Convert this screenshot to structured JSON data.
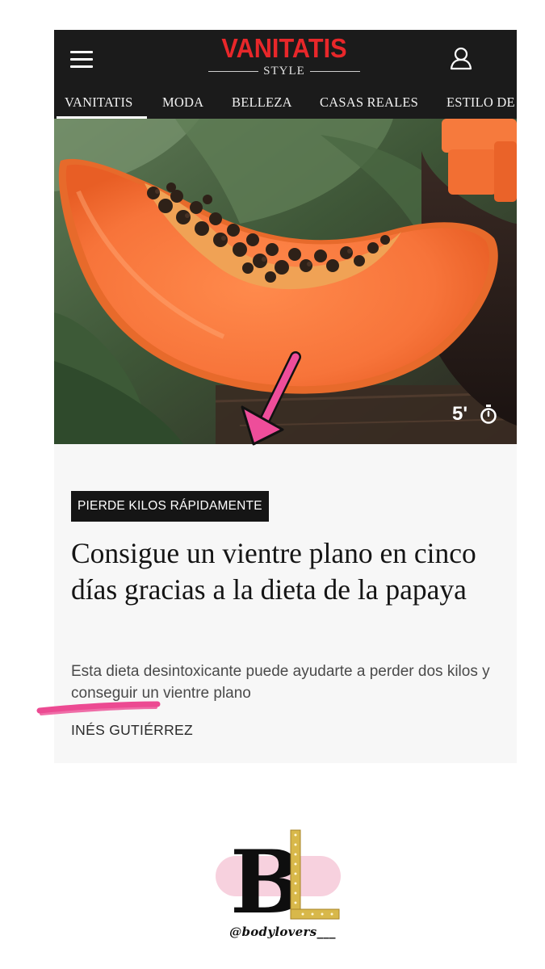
{
  "header": {
    "logo_main": "VANITATIS",
    "logo_sub": "STYLE",
    "menu_icon": "hamburger-menu-icon",
    "user_icon": "user-account-icon"
  },
  "nav": {
    "items": [
      "VANITATIS",
      "MODA",
      "BELLEZA",
      "CASAS REALES",
      "ESTILO DE"
    ],
    "active": "VANITATIS"
  },
  "article": {
    "hero_image": "papaya-slice-photo",
    "reading_time": "5'",
    "timer_icon": "stopwatch-icon",
    "tag": "PIERDE KILOS RÁPIDAMENTE",
    "headline": "Consigue un vientre plano en cinco días gracias a la dieta de la papaya",
    "summary": "Esta dieta desintoxicante puede ayudarte a perder dos kilos y conseguir un vientre plano",
    "author": "INÉS GUTIÉRREZ"
  },
  "annotations": {
    "arrow_color": "#ee4d9a",
    "underline_color": "#ec4a92"
  },
  "watermark": {
    "logo_letters": "BL",
    "handle": "@bodylovers___"
  }
}
